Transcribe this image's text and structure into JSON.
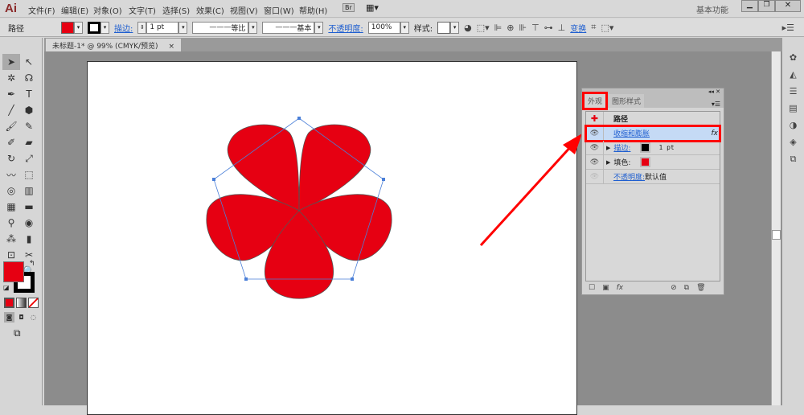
{
  "app": {
    "logo": "Ai",
    "workspace": "基本功能"
  },
  "menu": [
    "文件(F)",
    "编辑(E)",
    "对象(O)",
    "文字(T)",
    "选择(S)",
    "效果(C)",
    "视图(V)",
    "窗口(W)",
    "帮助(H)"
  ],
  "bridge_label": "Br",
  "control": {
    "object_type": "路径",
    "stroke_label": "描边:",
    "stroke_weight": "1 pt",
    "profile": "等比",
    "brush": "基本",
    "opacity_label": "不透明度:",
    "opacity": "100%",
    "style_label": "样式:",
    "transform_label": "变换"
  },
  "document_tab": {
    "title": "未标题-1* @ 99% (CMYK/预览)",
    "close": "×"
  },
  "colors": {
    "fill": "#e60012",
    "stroke": "#000000",
    "highlight": "#ff0000"
  },
  "appearance_panel": {
    "tabs": [
      "外观",
      "图形样式"
    ],
    "header": "路径",
    "rows": [
      {
        "label": "收缩和膨胀",
        "fx": "fx"
      },
      {
        "label": "描边:",
        "value": "1 pt"
      },
      {
        "label": "填色:"
      },
      {
        "label": "不透明度:",
        "value": "默认值"
      }
    ],
    "footer_fx": "fx"
  }
}
